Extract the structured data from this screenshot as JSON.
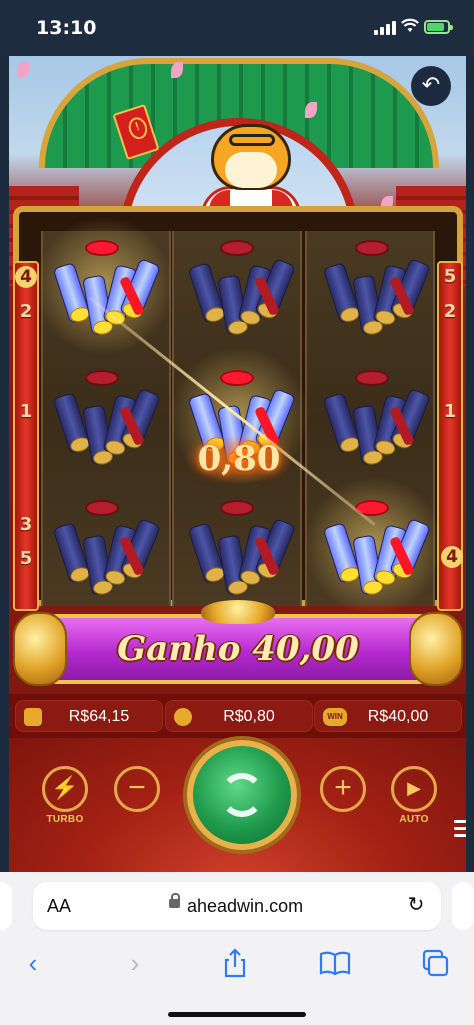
{
  "status_bar": {
    "time": "13:10",
    "signal_bars": 4,
    "battery_level": 0.85,
    "battery_charging": true,
    "battery_color": "#4cd964"
  },
  "game": {
    "reel_symbol": "firecracker-bundle",
    "side_rail": {
      "left": [
        "4",
        "2",
        "1",
        "3",
        "5"
      ],
      "right": [
        "5",
        "2",
        "1",
        "4"
      ]
    },
    "winning_positions": [
      [
        0,
        0
      ],
      [
        1,
        1
      ],
      [
        2,
        2
      ]
    ],
    "win_amount": "0,80",
    "banner_text": "Ganho 40,00",
    "accent_colors": {
      "gold": "#e7b24a",
      "red": "#a32114",
      "magenta": "#b62ad0",
      "green": "#1f9a4b"
    }
  },
  "info_bar": {
    "balance": "R$64,15",
    "bet": "R$0,80",
    "win_icon_label": "WIN",
    "win": "R$40,00"
  },
  "controls": {
    "turbo_label": "TURBO",
    "minus_symbol": "−",
    "plus_symbol": "+",
    "auto_label": "AUTO"
  },
  "browser": {
    "text_size_label": "AA",
    "url": "aheadwin.com"
  }
}
